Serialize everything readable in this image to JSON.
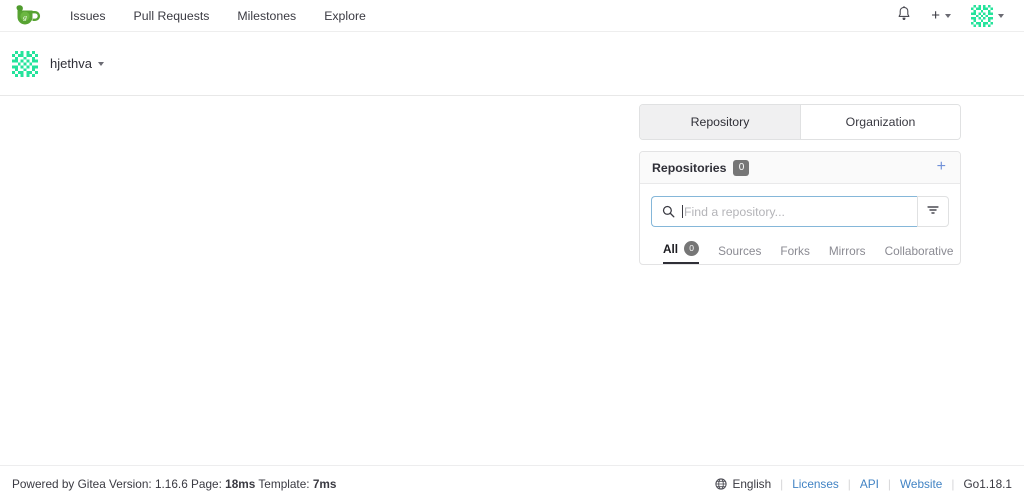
{
  "navbar": {
    "logo_icon": "gitea-teacup-logo",
    "items": [
      {
        "label": "Issues",
        "name": "nav-item-issues"
      },
      {
        "label": "Pull Requests",
        "name": "nav-item-pull-requests"
      },
      {
        "label": "Milestones",
        "name": "nav-item-milestones"
      },
      {
        "label": "Explore",
        "name": "nav-item-explore"
      }
    ],
    "notification_icon": "bell-icon",
    "create_icon": "plus-icon",
    "avatar_icon": "identicon-avatar",
    "accent_green": "#3bd68a"
  },
  "subheader": {
    "username": "hjethva",
    "avatar_icon": "identicon-avatar"
  },
  "panel": {
    "tabs": [
      {
        "label": "Repository",
        "active": true
      },
      {
        "label": "Organization",
        "active": false
      }
    ],
    "card": {
      "title": "Repositories",
      "count": "0",
      "add_label": "+",
      "add_color": "#7191d8",
      "search": {
        "placeholder": "Find a repository...",
        "value": "",
        "search_icon": "search-icon",
        "filter_icon": "filter-icon"
      },
      "filters": [
        {
          "label": "All",
          "badge": "0",
          "active": true
        },
        {
          "label": "Sources",
          "badge": null,
          "active": false
        },
        {
          "label": "Forks",
          "badge": null,
          "active": false
        },
        {
          "label": "Mirrors",
          "badge": null,
          "active": false
        },
        {
          "label": "Collaborative",
          "badge": null,
          "active": false
        }
      ]
    }
  },
  "footer": {
    "powered_prefix": "Powered by Gitea Version: 1.16.6 Page:",
    "page_time": "18ms",
    "template_prefix": "Template:",
    "template_time": "7ms",
    "language": "English",
    "language_icon": "globe-icon",
    "links": [
      {
        "label": "Licenses"
      },
      {
        "label": "API"
      },
      {
        "label": "Website"
      }
    ],
    "go_version": "Go1.18.1",
    "link_color": "#4183c4"
  }
}
